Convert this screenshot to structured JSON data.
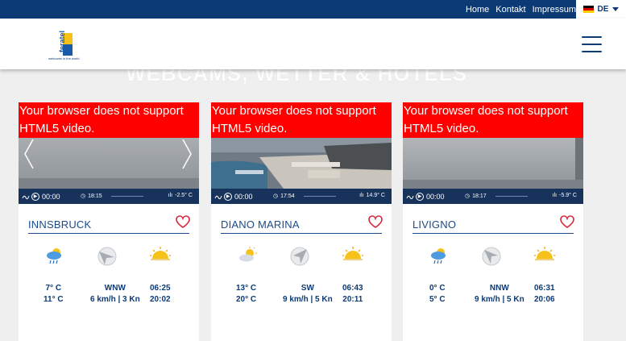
{
  "nav": {
    "links": [
      "Home",
      "Kontakt",
      "Impressum"
    ],
    "language": "DE"
  },
  "brand": {
    "logo_text": "feratel",
    "tagline": "webcams in the world",
    "accent": "#0b3a75"
  },
  "hero": {
    "title": "WEBCAMS, WETTER & HOTELS"
  },
  "video_message": "Your browser does not support HTML5 video.",
  "cards": [
    {
      "city": "INNSBRUCK",
      "video_time": "00:00",
      "clock": "18:15",
      "temp_overlay": "-2.5° C",
      "weather_icon": "rain-cloud-icon",
      "temp_high": "7° C",
      "temp_low": "11° C",
      "wind_dir": "WNW",
      "wind_speed": "6 km/h | 3 Kn",
      "sunrise": "06:25",
      "sunset": "20:02"
    },
    {
      "city": "DIANO MARINA",
      "video_time": "00:00",
      "clock": "17:54",
      "temp_overlay": "14.9° C",
      "weather_icon": "sun-cloud-icon",
      "temp_high": "13° C",
      "temp_low": "20° C",
      "wind_dir": "SW",
      "wind_speed": "9 km/h | 5 Kn",
      "sunrise": "06:43",
      "sunset": "20:11"
    },
    {
      "city": "LIVIGNO",
      "video_time": "00:00",
      "clock": "18:17",
      "temp_overlay": "-5.9° C",
      "weather_icon": "rain-cloud-icon",
      "temp_high": "0° C",
      "temp_low": "5° C",
      "wind_dir": "NNW",
      "wind_speed": "9 km/h | 5 Kn",
      "sunrise": "06:31",
      "sunset": "20:06"
    }
  ]
}
